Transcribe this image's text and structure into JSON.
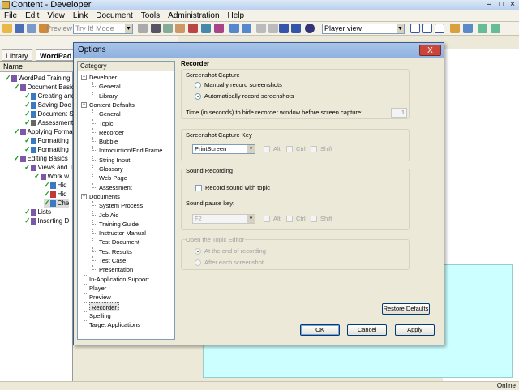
{
  "window": {
    "title": "Content - Developer"
  },
  "menu": [
    "File",
    "Edit",
    "View",
    "Link",
    "Document",
    "Tools",
    "Administration",
    "Help"
  ],
  "toolbar": {
    "preview_label": "Preview",
    "mode_value": "Try It! Mode",
    "view_value": "Player view"
  },
  "tabs": {
    "library": "Library",
    "document": "WordPad"
  },
  "left_panel": {
    "header": "Name",
    "tree": [
      "WordPad Training",
      "Document Basics",
      "Creating and",
      "Saving Doc",
      "Document S",
      "Assessment",
      "Applying Forma",
      "Formatting",
      "Formatting",
      "Editing Basics",
      "Views and T",
      "Work w",
      "Hid",
      "Hid",
      "Che",
      "Lists",
      "Inserting D"
    ]
  },
  "dialog": {
    "title": "Options",
    "close_label": "X",
    "category_header": "Category",
    "categories": [
      {
        "label": "Developer",
        "level": 0,
        "expanded": true
      },
      {
        "label": "General",
        "level": 1
      },
      {
        "label": "Library",
        "level": 1
      },
      {
        "label": "Content Defaults",
        "level": 0,
        "expanded": true
      },
      {
        "label": "General",
        "level": 1
      },
      {
        "label": "Topic",
        "level": 1
      },
      {
        "label": "Recorder",
        "level": 1
      },
      {
        "label": "Bubble",
        "level": 1
      },
      {
        "label": "Introduction/End Frame",
        "level": 1
      },
      {
        "label": "String Input",
        "level": 1
      },
      {
        "label": "Glossary",
        "level": 1
      },
      {
        "label": "Web Page",
        "level": 1
      },
      {
        "label": "Assessment",
        "level": 1
      },
      {
        "label": "Documents",
        "level": 0,
        "expanded": true
      },
      {
        "label": "System Process",
        "level": 1
      },
      {
        "label": "Job Aid",
        "level": 1
      },
      {
        "label": "Training Guide",
        "level": 1
      },
      {
        "label": "Instructor Manual",
        "level": 1
      },
      {
        "label": "Test Document",
        "level": 1
      },
      {
        "label": "Test Results",
        "level": 1
      },
      {
        "label": "Test Case",
        "level": 1
      },
      {
        "label": "Presentation",
        "level": 1
      },
      {
        "label": "In-Application Support",
        "level": 0
      },
      {
        "label": "Player",
        "level": 0
      },
      {
        "label": "Preview",
        "level": 0
      },
      {
        "label": "Recorder",
        "level": 0,
        "selected": true
      },
      {
        "label": "Spelling",
        "level": 0
      },
      {
        "label": "Target Applications",
        "level": 0
      }
    ],
    "recorder": {
      "heading": "Recorder",
      "screenshot_capture": {
        "title": "Screenshot Capture",
        "manual_label": "Manually record screenshots",
        "auto_label": "Automatically record screenshots",
        "selected": "auto",
        "time_label": "Time (in seconds) to hide recorder window before screen capture:",
        "time_value": "1"
      },
      "capture_key": {
        "title": "Screenshot Capture Key",
        "key_value": "PrintScreen",
        "alt": "Alt",
        "ctrl": "Ctrl",
        "shift": "Shift"
      },
      "sound": {
        "title": "Sound Recording",
        "record_label": "Record sound with topic",
        "pause_label": "Sound pause key:",
        "pause_value": "F2",
        "alt": "Alt",
        "ctrl": "Ctrl",
        "shift": "Shift"
      },
      "topic_editor": {
        "title": "Open the Topic Editor",
        "end_label": "At the end of recording",
        "each_label": "After each screenshot"
      }
    },
    "buttons": {
      "restore": "Restore Defaults",
      "ok": "OK",
      "cancel": "Cancel",
      "apply": "Apply"
    }
  },
  "status": {
    "online": "Online"
  }
}
